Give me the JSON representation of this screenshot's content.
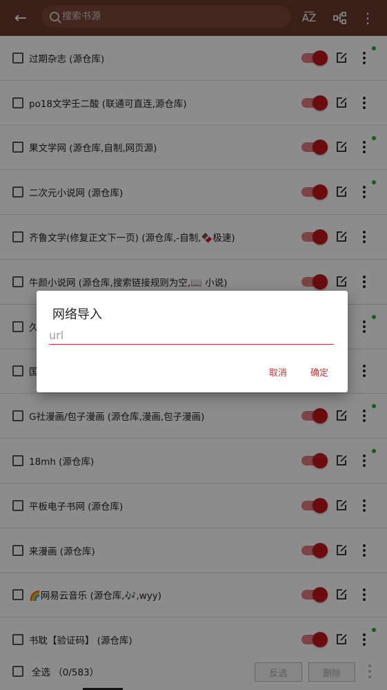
{
  "appbar": {
    "search_placeholder": "搜索书源",
    "back_icon": "arrow-left-icon",
    "sort_icon": "sort-az-icon",
    "group_icon": "tree-icon",
    "more_icon": "more-vert-icon",
    "bg": "#6b3a2c"
  },
  "list": [
    {
      "title": "过期杂志 (源仓库)",
      "dot": true
    },
    {
      "title": "po18文学壬二酸 (联通可直连,源仓库)",
      "dot": false
    },
    {
      "title": "果文学网 (源仓库,自制,网页源)",
      "dot": true
    },
    {
      "title": "二次元小说网 (源仓库)",
      "dot": true
    },
    {
      "title": "齐鲁文学(修复正文下一页) (源仓库,-自制,🍫极速)",
      "dot": false
    },
    {
      "title": "牛颜小说网 (源仓库,搜索链接规则为空,📖 小说)",
      "dot": false
    },
    {
      "title": "久",
      "dot": true
    },
    {
      "title": "国",
      "dot": false
    },
    {
      "title": "G社漫画/包子漫画 (源仓库,漫画,包子漫画)",
      "dot": true
    },
    {
      "title": "18mh (源仓库)",
      "dot": true
    },
    {
      "title": "平板电子书网 (源仓库)",
      "dot": false
    },
    {
      "title": "来漫画 (源仓库)",
      "dot": false
    },
    {
      "title": "🌈网易云音乐 (源仓库,🎶,wyy)",
      "dot": false
    },
    {
      "title": "书耽【验证码】 (源仓库)",
      "dot": true
    }
  ],
  "bottombar": {
    "select_all": "全选 （0/583）",
    "invert": "反选",
    "delete": "删除"
  },
  "dialog": {
    "title": "网络导入",
    "input_placeholder": "url",
    "input_value": "",
    "cancel": "取消",
    "confirm": "确定",
    "accent": "#d32f2f"
  }
}
